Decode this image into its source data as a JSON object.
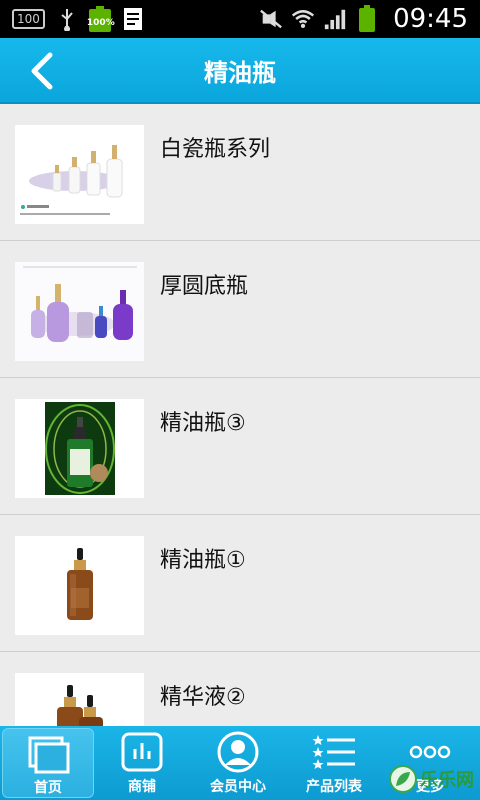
{
  "status_bar": {
    "badge": "100",
    "battery_small_pct": "100%",
    "time": "09:45"
  },
  "header": {
    "title": "精油瓶"
  },
  "items": [
    {
      "label": "白瓷瓶系列",
      "caption": "白玉精油瓶"
    },
    {
      "label": "厚圆底瓶"
    },
    {
      "label": "精油瓶③"
    },
    {
      "label": "精油瓶①"
    },
    {
      "label": "精华液②"
    }
  ],
  "tabs": [
    {
      "label": "首页",
      "icon": "home-icon"
    },
    {
      "label": "商铺",
      "icon": "shop-icon"
    },
    {
      "label": "会员中心",
      "icon": "member-icon"
    },
    {
      "label": "产品列表",
      "icon": "product-list-icon"
    },
    {
      "label": "更多",
      "icon": "more-icon"
    }
  ],
  "watermark": "乐乐网",
  "colors": {
    "header": "#0aa6db",
    "tabbar": "#0d9bd1",
    "list_bg": "#ececec"
  }
}
